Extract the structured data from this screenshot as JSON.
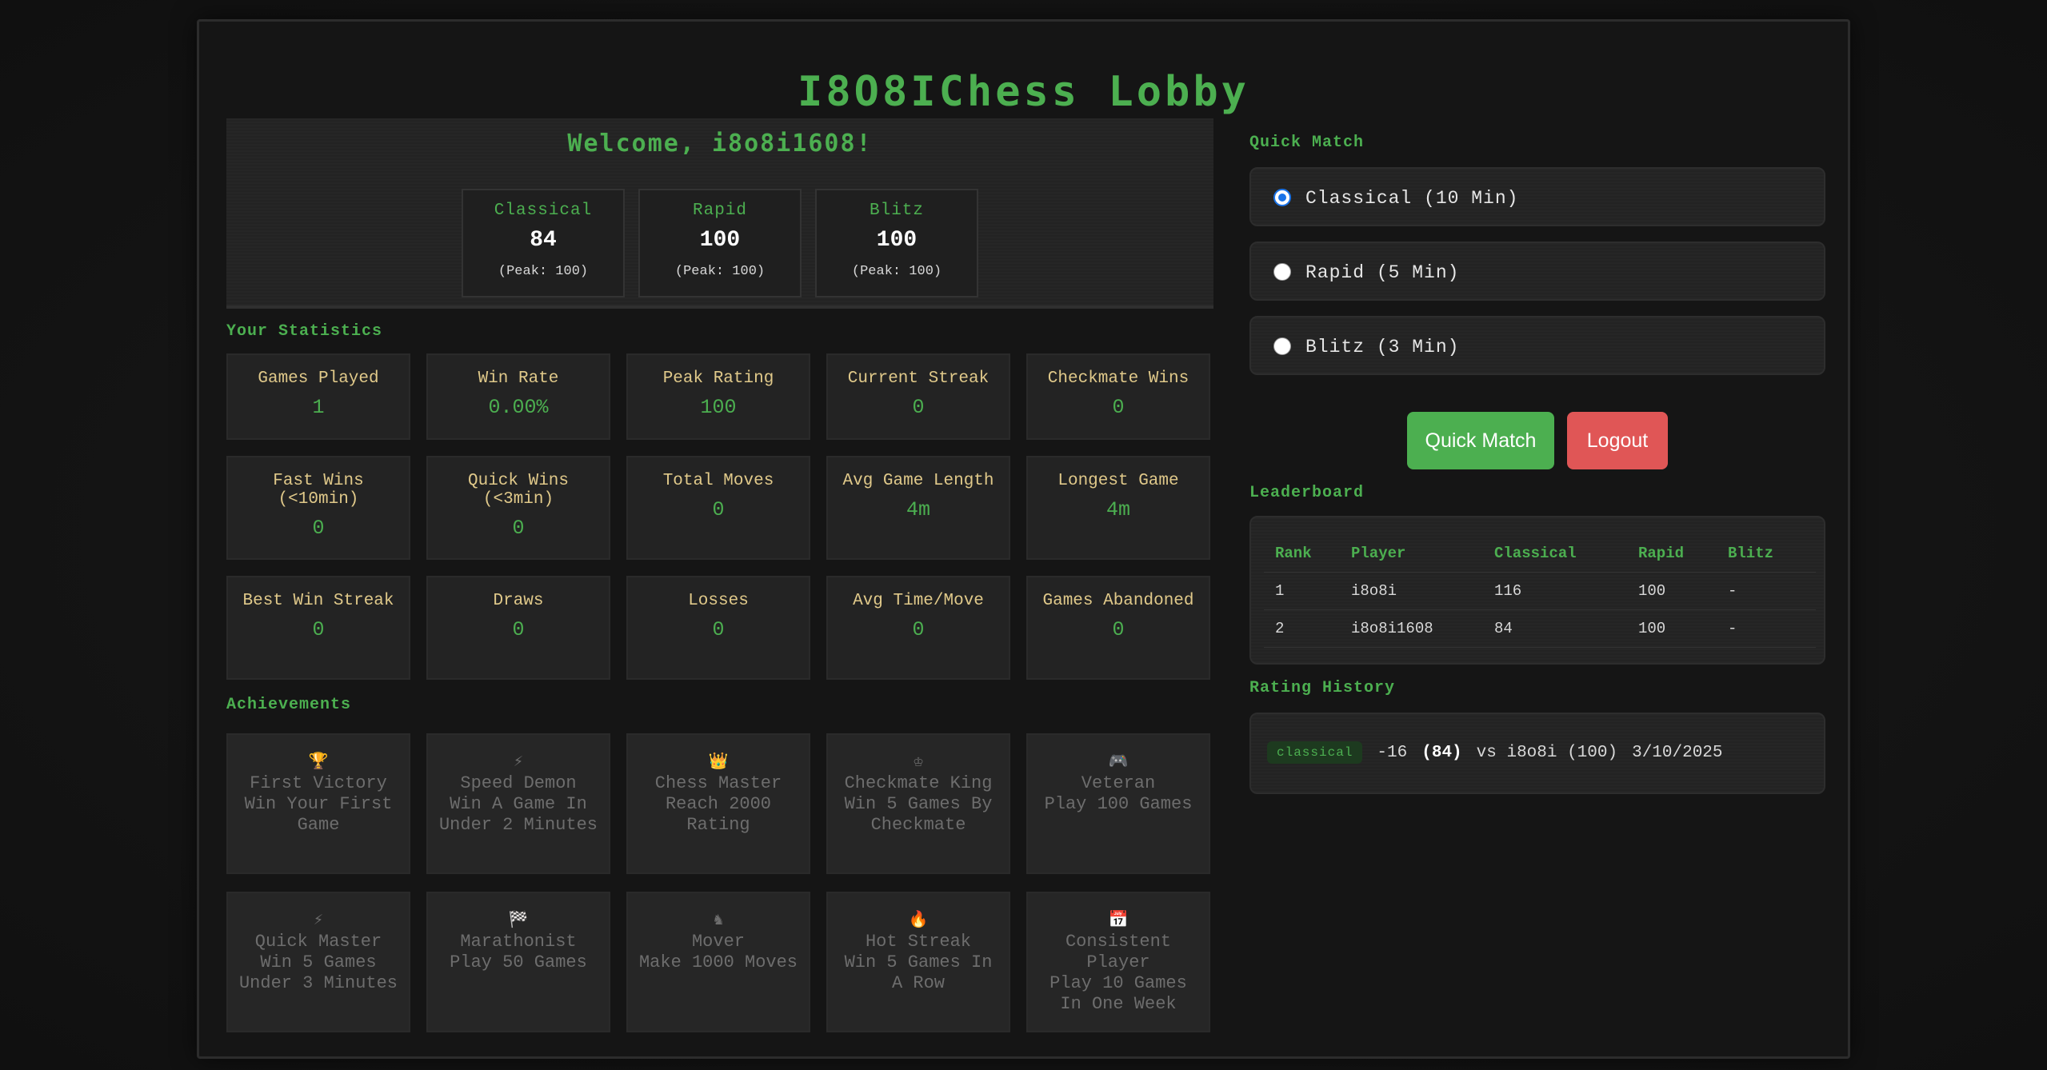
{
  "title": "I8O8IChess Lobby",
  "welcome": "Welcome, i8o8i1608!",
  "ratings": [
    {
      "name": "Classical",
      "value": "84",
      "peak": "(Peak: 100)"
    },
    {
      "name": "Rapid",
      "value": "100",
      "peak": "(Peak: 100)"
    },
    {
      "name": "Blitz",
      "value": "100",
      "peak": "(Peak: 100)"
    }
  ],
  "statistics": {
    "label": "Your Statistics",
    "cards": [
      {
        "label": "Games Played",
        "value": "1"
      },
      {
        "label": "Win Rate",
        "value": "0.00%"
      },
      {
        "label": "Peak Rating",
        "value": "100"
      },
      {
        "label": "Current Streak",
        "value": "0"
      },
      {
        "label": "Checkmate Wins",
        "value": "0"
      },
      {
        "label": "Fast Wins (<10min)",
        "value": "0"
      },
      {
        "label": "Quick Wins (<3min)",
        "value": "0"
      },
      {
        "label": "Total Moves",
        "value": "0"
      },
      {
        "label": "Avg Game Length",
        "value": "4m"
      },
      {
        "label": "Longest Game",
        "value": "4m"
      },
      {
        "label": "Best Win Streak",
        "value": "0"
      },
      {
        "label": "Draws",
        "value": "0"
      },
      {
        "label": "Losses",
        "value": "0"
      },
      {
        "label": "Avg Time/Move",
        "value": "0"
      },
      {
        "label": "Games Abandoned",
        "value": "0"
      }
    ]
  },
  "achievements": {
    "label": "Achievements",
    "items": [
      {
        "icon": "trophy-icon",
        "glyph": "🏆",
        "name": "First Victory",
        "desc": "Win Your First Game"
      },
      {
        "icon": "lightning-icon",
        "glyph": "⚡",
        "name": "Speed Demon",
        "desc": "Win A Game In Under 2 Minutes"
      },
      {
        "icon": "crown-icon",
        "glyph": "👑",
        "name": "Chess Master",
        "desc": "Reach 2000 Rating"
      },
      {
        "icon": "king-icon",
        "glyph": "♔",
        "name": "Checkmate King",
        "desc": "Win 5 Games By Checkmate"
      },
      {
        "icon": "gamepad-icon",
        "glyph": "🎮",
        "name": "Veteran",
        "desc": "Play 100 Games"
      },
      {
        "icon": "lightning-icon",
        "glyph": "⚡",
        "name": "Quick Master",
        "desc": "Win 5 Games Under 3 Minutes"
      },
      {
        "icon": "checkered-flag-icon",
        "glyph": "🏁",
        "name": "Marathonist",
        "desc": "Play 50 Games"
      },
      {
        "icon": "knight-icon",
        "glyph": "♞",
        "name": "Mover",
        "desc": "Make 1000 Moves"
      },
      {
        "icon": "fire-icon",
        "glyph": "🔥",
        "name": "Hot Streak",
        "desc": "Win 5 Games In A Row"
      },
      {
        "icon": "calendar-icon",
        "glyph": "📅",
        "name": "Consistent Player",
        "desc": "Play 10 Games In One Week"
      }
    ]
  },
  "quick_match": {
    "label": "Quick Match",
    "options": [
      {
        "label": "Classical (10 Min)",
        "checked": true
      },
      {
        "label": "Rapid (5 Min)",
        "checked": false
      },
      {
        "label": "Blitz (3 Min)",
        "checked": false
      }
    ],
    "quick_match_button": "Quick Match",
    "logout_button": "Logout"
  },
  "leaderboard": {
    "label": "Leaderboard",
    "columns": [
      "Rank",
      "Player",
      "Classical",
      "Rapid",
      "Blitz"
    ],
    "rows": [
      [
        "1",
        "i8o8i",
        "116",
        "100",
        "-"
      ],
      [
        "2",
        "i8o8i1608",
        "84",
        "100",
        "-"
      ]
    ]
  },
  "rating_history": {
    "label": "Rating History",
    "entries": [
      {
        "mode": "classical",
        "change": "-16",
        "rating": "(84)",
        "opponent": "vs i8o8i (100)",
        "date": "3/10/2025"
      }
    ]
  },
  "colors": {
    "accent": "#4caf50",
    "danger": "#e05656",
    "stat_label": "#e0c98a",
    "background": "#151515"
  }
}
